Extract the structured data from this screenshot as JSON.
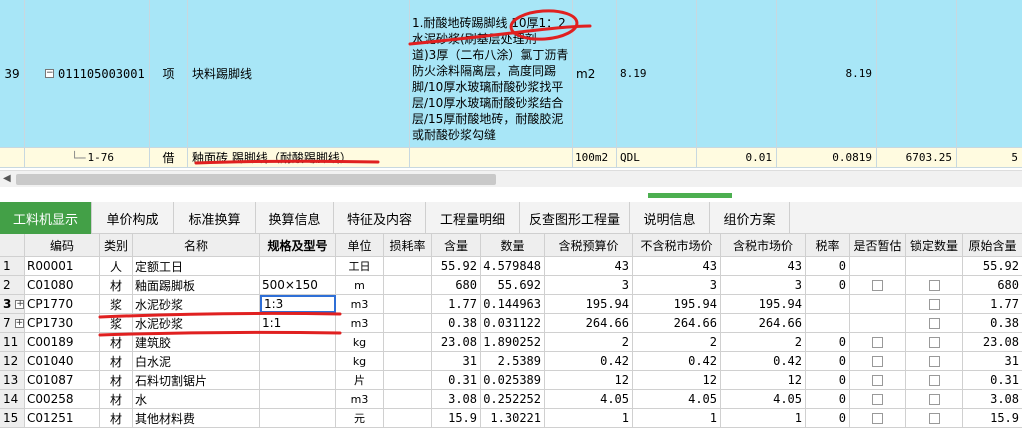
{
  "upper": {
    "main_row": {
      "row_no": "39",
      "expander": "−",
      "code": "011105003001",
      "type": "项",
      "name": "块料踢脚线",
      "description": "1.耐酸地砖踢脚线 10厚1：2水泥砂浆(刷基层处理剂一道)3厚（二布八涂）氯丁沥青防火涂料隔离层，高度同踢脚/10厚水玻璃耐酸砂浆找平层/10厚水玻璃耐酸砂浆结合层/15厚耐酸地砖，耐酸胶泥或耐酸砂浆勾缝",
      "unit": "m2",
      "qty_expr": "8.19",
      "qty": "8.19"
    },
    "sub_row": {
      "code": "1-76",
      "type": "借",
      "name": "釉面砖 踢脚线（耐酸踢脚线）",
      "unit": "100m2",
      "qty_expr": "QDL",
      "content": "0.01",
      "qty": "0.0819",
      "price": "6703.25",
      "extra": "5"
    }
  },
  "tabs": [
    {
      "label": "工料机显示",
      "active": true
    },
    {
      "label": "单价构成",
      "active": false
    },
    {
      "label": "标准换算",
      "active": false
    },
    {
      "label": "换算信息",
      "active": false
    },
    {
      "label": "特征及内容",
      "active": false
    },
    {
      "label": "工程量明细",
      "active": false
    },
    {
      "label": "反查图形工程量",
      "active": false
    },
    {
      "label": "说明信息",
      "active": false
    },
    {
      "label": "组价方案",
      "active": false
    }
  ],
  "grid": {
    "headers": [
      "",
      "编码",
      "类别",
      "名称",
      "规格及型号",
      "单位",
      "损耗率",
      "含量",
      "数量",
      "含税预算价",
      "不含税市场价",
      "含税市场价",
      "税率",
      "是否暂估",
      "锁定数量",
      "原始含量"
    ],
    "rows": [
      {
        "no": "1",
        "exp": "",
        "code": "R00001",
        "cat": "人",
        "name": "定额工日",
        "spec": "",
        "unit": "工日",
        "loss": "",
        "content": "55.92",
        "qty": "4.579848",
        "tax_budget": "43",
        "market_ex": "43",
        "market_in": "43",
        "rate": "0",
        "est": false,
        "lock": false,
        "orig": "55.92"
      },
      {
        "no": "2",
        "exp": "",
        "code": "C01080",
        "cat": "材",
        "name": "釉面踢脚板",
        "spec": "500×150",
        "unit": "m",
        "loss": "",
        "content": "680",
        "qty": "55.692",
        "tax_budget": "3",
        "market_ex": "3",
        "market_in": "3",
        "rate": "0",
        "est": true,
        "lock": true,
        "orig": "680"
      },
      {
        "no": "3",
        "exp": "+",
        "code": "CP1770",
        "cat": "浆",
        "name": "水泥砂浆",
        "spec": "1:3",
        "unit": "m3",
        "loss": "",
        "content": "1.77",
        "qty": "0.144963",
        "tax_budget": "195.94",
        "market_ex": "195.94",
        "market_in": "195.94",
        "rate": "",
        "est": false,
        "lock": true,
        "orig": "1.77"
      },
      {
        "no": "7",
        "exp": "+",
        "code": "CP1730",
        "cat": "浆",
        "name": "水泥砂浆",
        "spec": "1:1",
        "unit": "m3",
        "loss": "",
        "content": "0.38",
        "qty": "0.031122",
        "tax_budget": "264.66",
        "market_ex": "264.66",
        "market_in": "264.66",
        "rate": "",
        "est": false,
        "lock": true,
        "orig": "0.38"
      },
      {
        "no": "11",
        "exp": "",
        "code": "C00189",
        "cat": "材",
        "name": "建筑胶",
        "spec": "",
        "unit": "kg",
        "loss": "",
        "content": "23.08",
        "qty": "1.890252",
        "tax_budget": "2",
        "market_ex": "2",
        "market_in": "2",
        "rate": "0",
        "est": true,
        "lock": true,
        "orig": "23.08"
      },
      {
        "no": "12",
        "exp": "",
        "code": "C01040",
        "cat": "材",
        "name": "白水泥",
        "spec": "",
        "unit": "kg",
        "loss": "",
        "content": "31",
        "qty": "2.5389",
        "tax_budget": "0.42",
        "market_ex": "0.42",
        "market_in": "0.42",
        "rate": "0",
        "est": true,
        "lock": true,
        "orig": "31"
      },
      {
        "no": "13",
        "exp": "",
        "code": "C01087",
        "cat": "材",
        "name": "石料切割锯片",
        "spec": "",
        "unit": "片",
        "loss": "",
        "content": "0.31",
        "qty": "0.025389",
        "tax_budget": "12",
        "market_ex": "12",
        "market_in": "12",
        "rate": "0",
        "est": true,
        "lock": true,
        "orig": "0.31"
      },
      {
        "no": "14",
        "exp": "",
        "code": "C00258",
        "cat": "材",
        "name": "水",
        "spec": "",
        "unit": "m3",
        "loss": "",
        "content": "3.08",
        "qty": "0.252252",
        "tax_budget": "4.05",
        "market_ex": "4.05",
        "market_in": "4.05",
        "rate": "0",
        "est": true,
        "lock": true,
        "orig": "3.08"
      },
      {
        "no": "15",
        "exp": "",
        "code": "C01251",
        "cat": "材",
        "name": "其他材料费",
        "spec": "",
        "unit": "元",
        "loss": "",
        "content": "15.9",
        "qty": "1.30221",
        "tax_budget": "1",
        "market_ex": "1",
        "market_in": "1",
        "rate": "0",
        "est": true,
        "lock": true,
        "orig": "15.9"
      }
    ]
  },
  "colors": {
    "active_tab": "#43a047",
    "main_row": "#a8e6f7",
    "annotation": "#e02020"
  }
}
